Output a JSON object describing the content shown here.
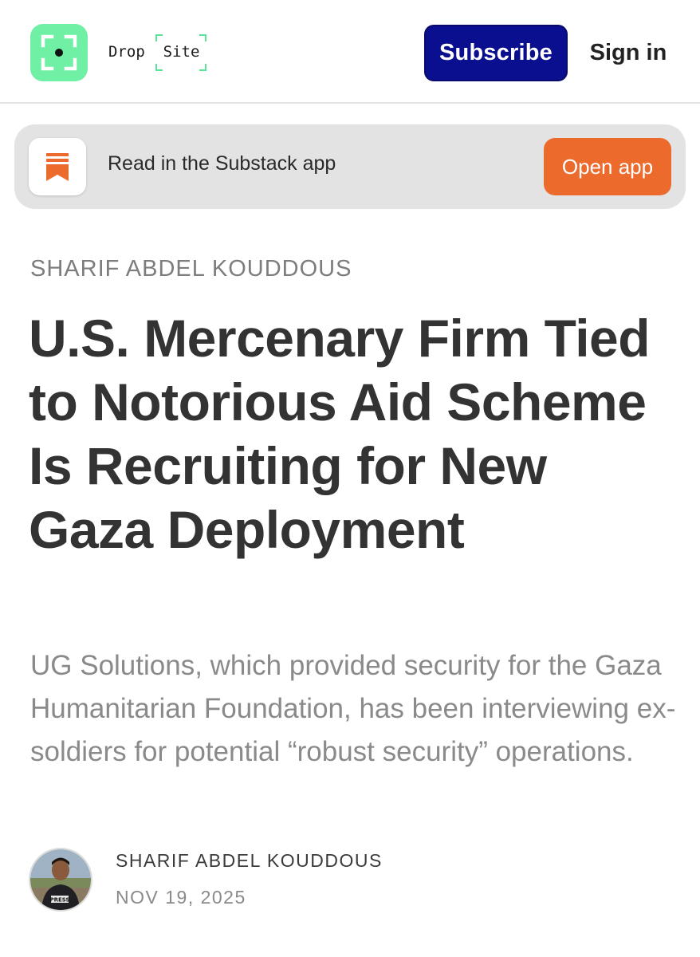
{
  "header": {
    "logo_icon": "viewfinder-dot-icon",
    "brand_word_1": "Drop",
    "brand_word_2": "Site",
    "subscribe_label": "Subscribe",
    "signin_label": "Sign in",
    "colors": {
      "logo_badge": "#6ff0a4",
      "subscribe_bg": "#0a0f8f"
    }
  },
  "app_banner": {
    "icon": "substack-bookmark-icon",
    "text": "Read in the Substack app",
    "button_label": "Open app",
    "colors": {
      "button_bg": "#ec6a2c",
      "banner_bg": "#e3e3e3"
    }
  },
  "article": {
    "kicker": "SHARIF ABDEL KOUDDOUS",
    "title": "U.S. Mercenary Firm Tied to Notorious Aid Scheme Is Recruiting for New Gaza Deployment",
    "subtitle": "UG Solutions, which provided security for the Gaza Humanitarian Foundation, has been interviewing ex-soldiers for potential “robust security” operations.",
    "byline": {
      "author": "SHARIF ABDEL KOUDDOUS",
      "date": "NOV 19, 2025",
      "avatar_label": "PRESS"
    }
  }
}
